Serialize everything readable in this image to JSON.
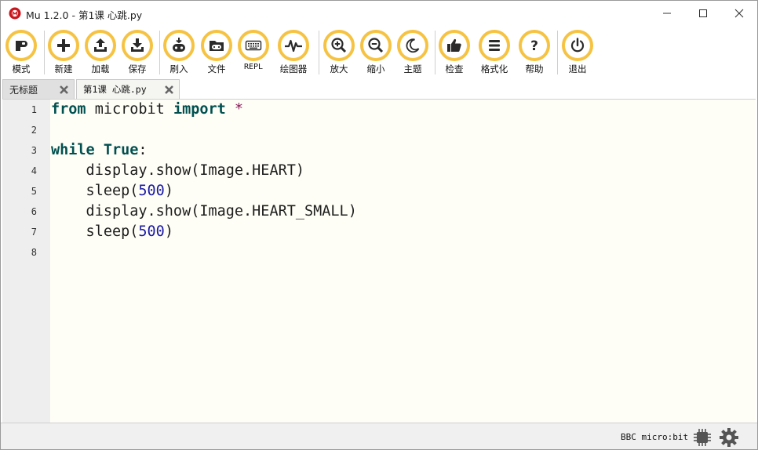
{
  "window": {
    "title": "Mu 1.2.0 - 第1课 心跳.py",
    "controls": [
      "minimize",
      "maximize",
      "close"
    ]
  },
  "toolbar": {
    "buttons": [
      {
        "id": "mode",
        "label": "模式",
        "icon": "mode-icon"
      },
      {
        "id": "new",
        "label": "新建",
        "icon": "plus-icon"
      },
      {
        "id": "load",
        "label": "加载",
        "icon": "upload-icon"
      },
      {
        "id": "save",
        "label": "保存",
        "icon": "download-icon"
      },
      {
        "id": "flash",
        "label": "刷入",
        "icon": "flash-icon"
      },
      {
        "id": "files",
        "label": "文件",
        "icon": "files-icon"
      },
      {
        "id": "repl",
        "label": "REPL",
        "icon": "keyboard-icon"
      },
      {
        "id": "plotter",
        "label": "绘图器",
        "icon": "pulse-icon"
      },
      {
        "id": "zoom_in",
        "label": "放大",
        "icon": "zoom-in-icon"
      },
      {
        "id": "zoom_out",
        "label": "缩小",
        "icon": "zoom-out-icon"
      },
      {
        "id": "theme",
        "label": "主题",
        "icon": "moon-icon"
      },
      {
        "id": "check",
        "label": "检查",
        "icon": "thumbs-up-icon"
      },
      {
        "id": "tidy",
        "label": "格式化",
        "icon": "lines-icon"
      },
      {
        "id": "help",
        "label": "帮助",
        "icon": "question-icon"
      },
      {
        "id": "quit",
        "label": "退出",
        "icon": "power-icon"
      }
    ],
    "accent_color": "#f5c242"
  },
  "tabs": [
    {
      "label": "无标题",
      "active": false
    },
    {
      "label": "第1课 心跳.py",
      "active": true
    }
  ],
  "editor": {
    "line_numbers": [
      "1",
      "2",
      "3",
      "4",
      "5",
      "6",
      "7",
      "8"
    ],
    "lines": [
      "from microbit import *",
      "",
      "while True:",
      "    display.show(Image.HEART)",
      "    sleep(500)",
      "    display.show(Image.HEART_SMALL)",
      "    sleep(500)",
      ""
    ],
    "background": "#fffef6"
  },
  "statusbar": {
    "mode": "BBC micro:bit",
    "icons": [
      "chip-icon",
      "gear-icon"
    ]
  }
}
